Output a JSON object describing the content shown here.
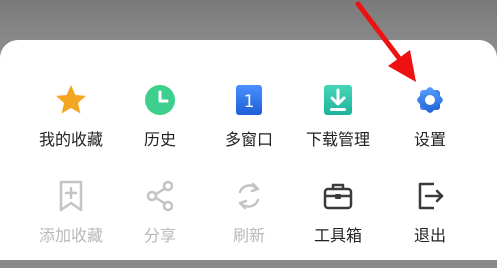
{
  "menu": {
    "row1": [
      {
        "label": "我的收藏",
        "icon": "star-icon",
        "color": "#f5a524"
      },
      {
        "label": "历史",
        "icon": "clock-icon",
        "color": "#3ecf8e"
      },
      {
        "label": "多窗口",
        "icon": "window-count-icon",
        "badge": "1",
        "color": "#2f7bf6"
      },
      {
        "label": "下载管理",
        "icon": "download-icon",
        "color": "#27c1b0"
      },
      {
        "label": "设置",
        "icon": "gear-icon",
        "color": "#2f7bf6"
      }
    ],
    "row2": [
      {
        "label": "添加收藏",
        "icon": "add-bookmark-icon",
        "disabled": true
      },
      {
        "label": "分享",
        "icon": "share-icon",
        "disabled": true
      },
      {
        "label": "刷新",
        "icon": "refresh-icon",
        "disabled": true
      },
      {
        "label": "工具箱",
        "icon": "toolbox-icon",
        "disabled": false
      },
      {
        "label": "退出",
        "icon": "exit-icon",
        "disabled": false
      }
    ]
  },
  "colors": {
    "arrow": "#ee1111",
    "disabled": "#c4c4c4",
    "enabled_outline": "#3a3a3a"
  }
}
